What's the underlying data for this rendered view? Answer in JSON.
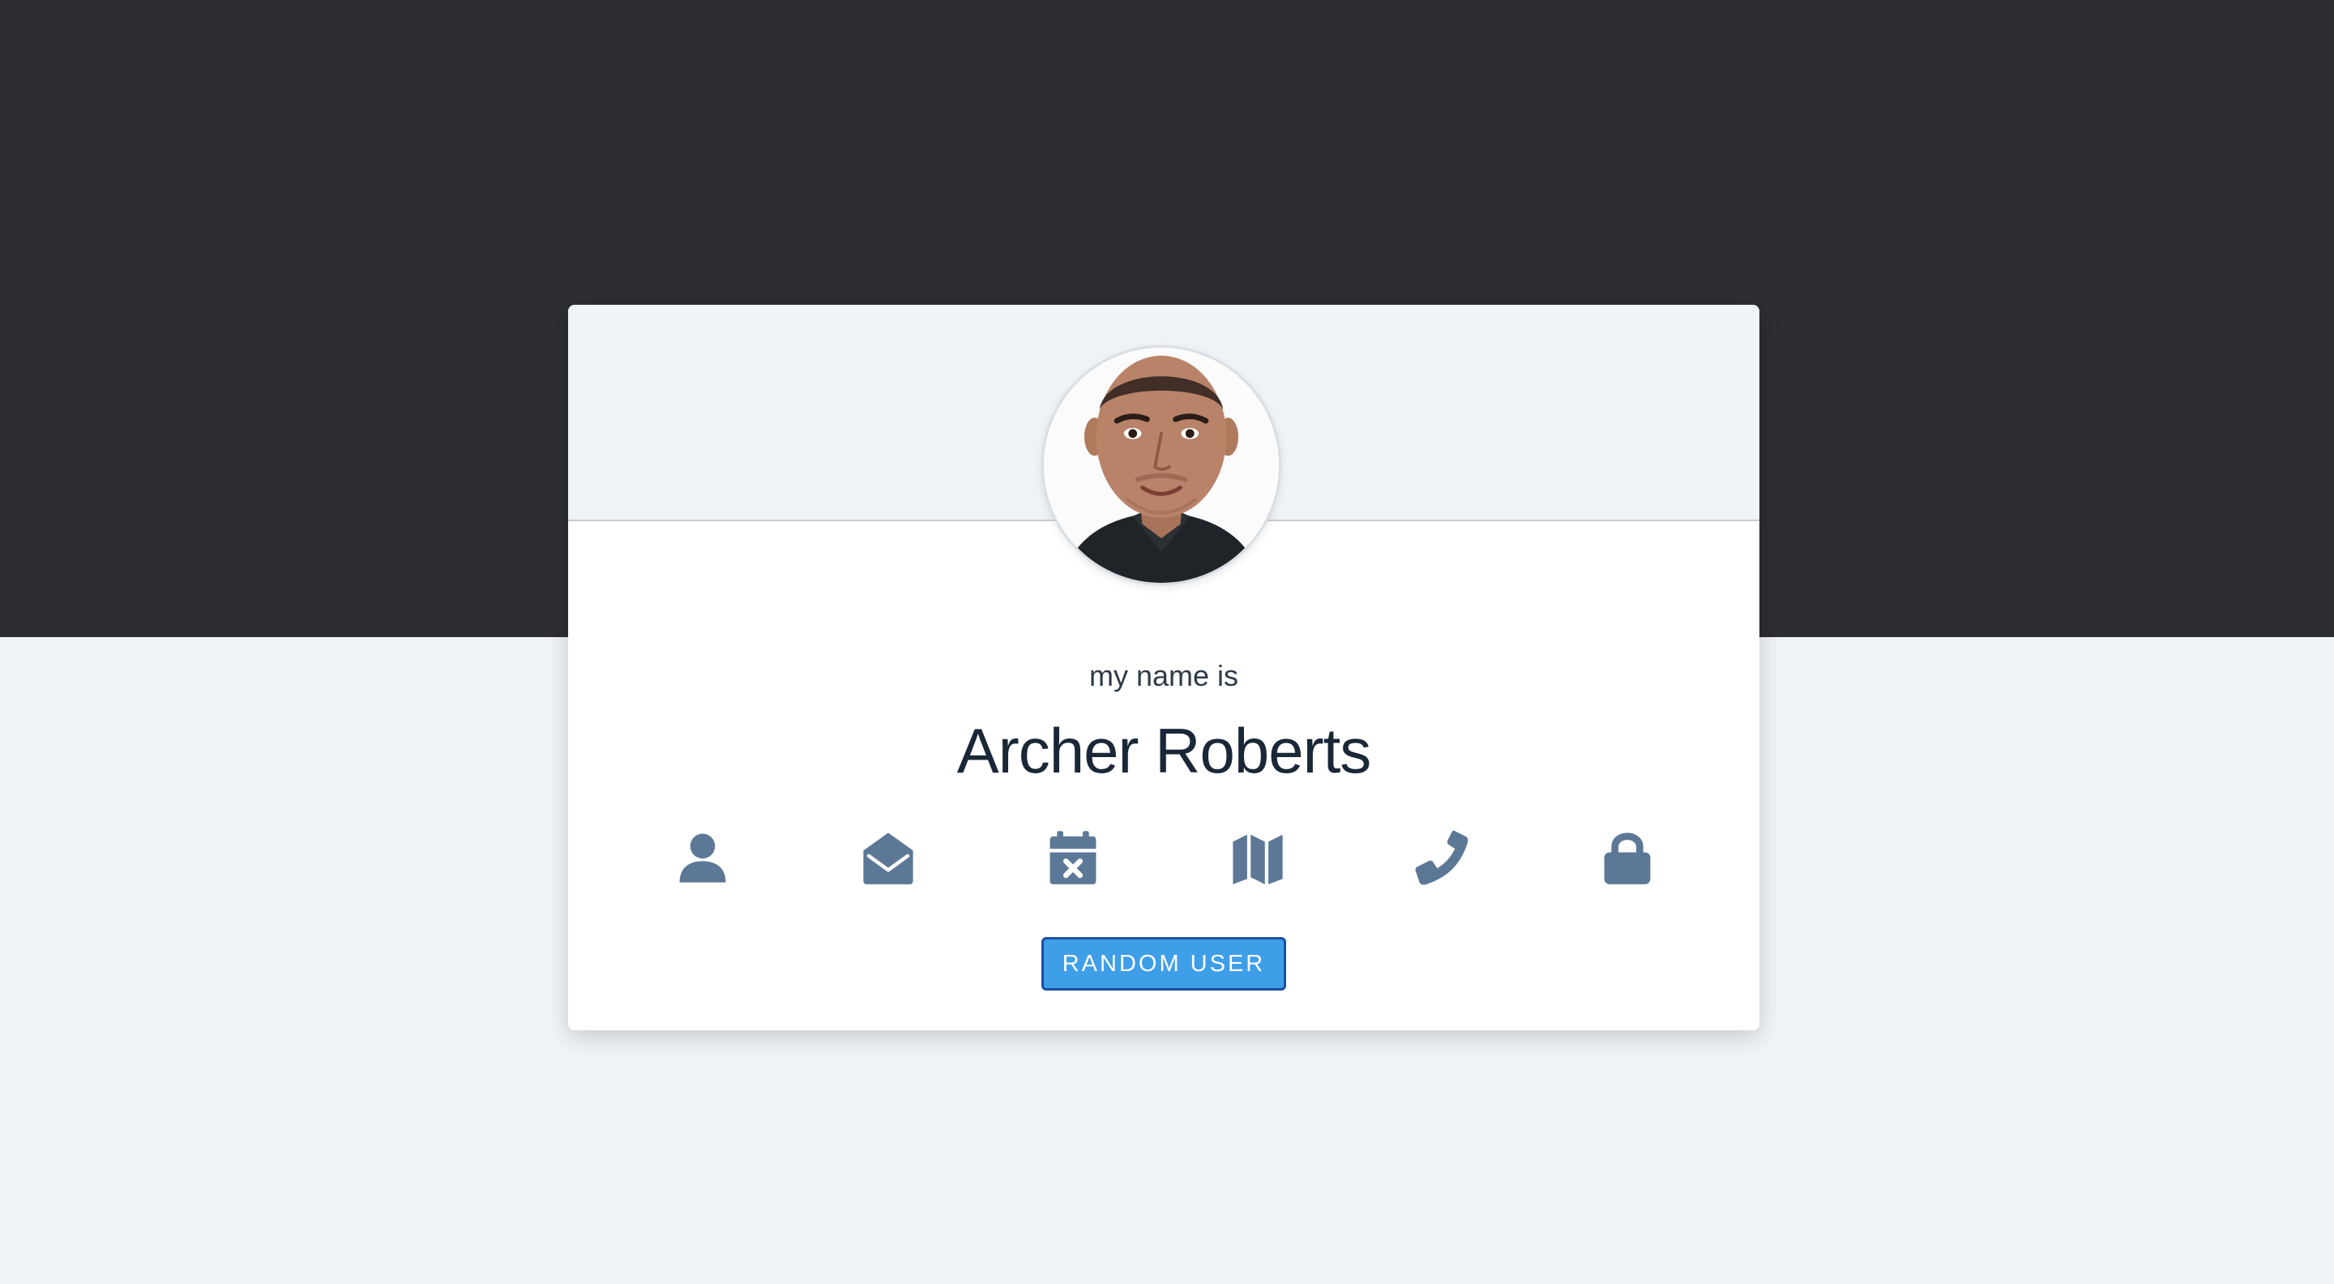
{
  "profile": {
    "subtitle": "my name is",
    "name": "Archer Roberts",
    "avatar_alt": "profile photo"
  },
  "icons": [
    {
      "name": "user-icon"
    },
    {
      "name": "envelope-open-icon"
    },
    {
      "name": "calendar-x-icon"
    },
    {
      "name": "map-icon"
    },
    {
      "name": "phone-icon"
    },
    {
      "name": "lock-icon"
    }
  ],
  "actions": {
    "random_user_label": "RANDOM USER"
  },
  "colors": {
    "top_band": "#2c2e33",
    "page_background": "#f1f4f7",
    "card_header": "#f0f3f6",
    "icon": "#5d7896",
    "button": "#3f9ee8",
    "button_border": "#1c4fa3",
    "name_text": "#1a2737"
  }
}
